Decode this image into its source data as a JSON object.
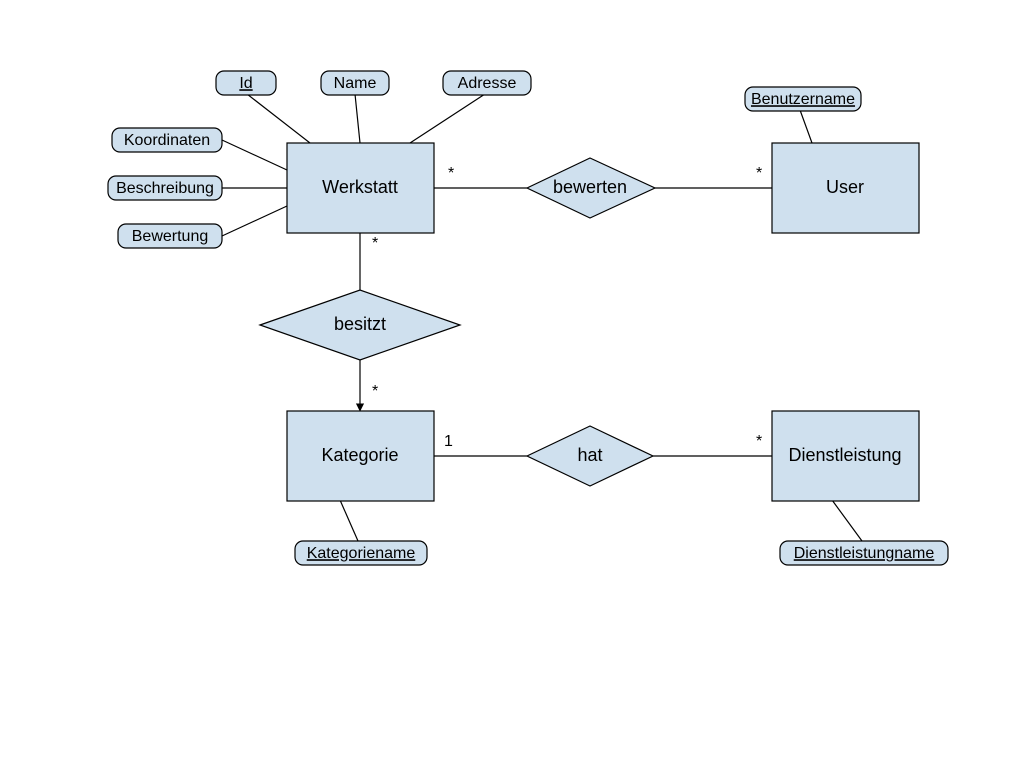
{
  "diagram_type": "Entity-Relationship Diagram",
  "entities": {
    "werkstatt": {
      "label": "Werkstatt"
    },
    "user": {
      "label": "User"
    },
    "kategorie": {
      "label": "Kategorie"
    },
    "dienstleistung": {
      "label": "Dienstleistung"
    }
  },
  "relationships": {
    "bewerten": {
      "label": "bewerten"
    },
    "besitzt": {
      "label": "besitzt"
    },
    "hat": {
      "label": "hat"
    }
  },
  "attributes": {
    "id": {
      "label": "Id",
      "key": true
    },
    "name": {
      "label": "Name",
      "key": false
    },
    "adresse": {
      "label": "Adresse",
      "key": false
    },
    "koordinaten": {
      "label": "Koordinaten",
      "key": false
    },
    "beschreibung": {
      "label": "Beschreibung",
      "key": false
    },
    "bewertung": {
      "label": "Bewertung",
      "key": false
    },
    "benutzername": {
      "label": "Benutzername",
      "key": true
    },
    "kategoriename": {
      "label": "Kategoriename",
      "key": true
    },
    "dienstleistungname": {
      "label": "Dienstleistungname",
      "key": true
    }
  },
  "cardinalities": {
    "werkstatt_bewerten": "*",
    "user_bewerten": "*",
    "werkstatt_besitzt": "*",
    "kategorie_besitzt": "*",
    "kategorie_hat": "1",
    "dienstleistung_hat": "*"
  },
  "colors": {
    "shape_fill": "#cfe0ee",
    "stroke": "#000000"
  }
}
